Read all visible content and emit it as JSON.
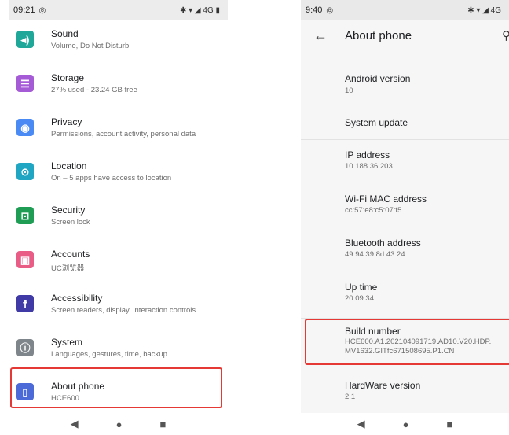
{
  "left_phone": {
    "status": {
      "time": "09:21",
      "right_icons": "✱ ▾ ◢ 4G ▮"
    },
    "items": [
      {
        "title": "Sound",
        "subtitle": "Volume, Do Not Disturb",
        "icon": "volume-icon",
        "color": "#1fa89a"
      },
      {
        "title": "Storage",
        "subtitle": "27% used - 23.24 GB free",
        "icon": "storage-icon",
        "color": "#a55ad6"
      },
      {
        "title": "Privacy",
        "subtitle": "Permissions, account activity, personal data",
        "icon": "privacy-icon",
        "color": "#4a8af4"
      },
      {
        "title": "Location",
        "subtitle": "On – 5 apps have access to location",
        "icon": "location-icon",
        "color": "#20a6c2"
      },
      {
        "title": "Security",
        "subtitle": "Screen lock",
        "icon": "lock-icon",
        "color": "#1f9d55"
      },
      {
        "title": "Accounts",
        "subtitle": "UC浏览器",
        "icon": "accounts-icon",
        "color": "#e85c86"
      },
      {
        "title": "Accessibility",
        "subtitle": "Screen readers, display, interaction controls",
        "icon": "accessibility-icon",
        "color": "#3f3aa6"
      },
      {
        "title": "System",
        "subtitle": "Languages, gestures, time, backup",
        "icon": "info-icon",
        "color": "#7f868b"
      },
      {
        "title": "About phone",
        "subtitle": "HCE600",
        "icon": "phone-icon",
        "color": "#4c6bd9"
      }
    ]
  },
  "right_phone": {
    "status": {
      "time": "9:40",
      "right_icons": "✱ ▾ ◢ 4G"
    },
    "title": "About phone",
    "items": [
      {
        "title": "Android version",
        "value": "10"
      },
      {
        "title": "System update",
        "value": ""
      },
      {
        "title": "IP address",
        "value": "10.188.36.203"
      },
      {
        "title": "Wi-Fi MAC address",
        "value": "cc:57:e8:c5:07:f5"
      },
      {
        "title": "Bluetooth address",
        "value": "49:94:39:8d:43:24"
      },
      {
        "title": "Up time",
        "value": "20:09:34"
      },
      {
        "title": "Build number",
        "value": "HCE600.A1.202104091719.AD10.V20.HDP.",
        "value2": "MV1632.GITfc671508695.P1.CN"
      },
      {
        "title": "HardWare version",
        "value": "2.1"
      }
    ]
  },
  "colors": {
    "highlight": "#e53935"
  }
}
